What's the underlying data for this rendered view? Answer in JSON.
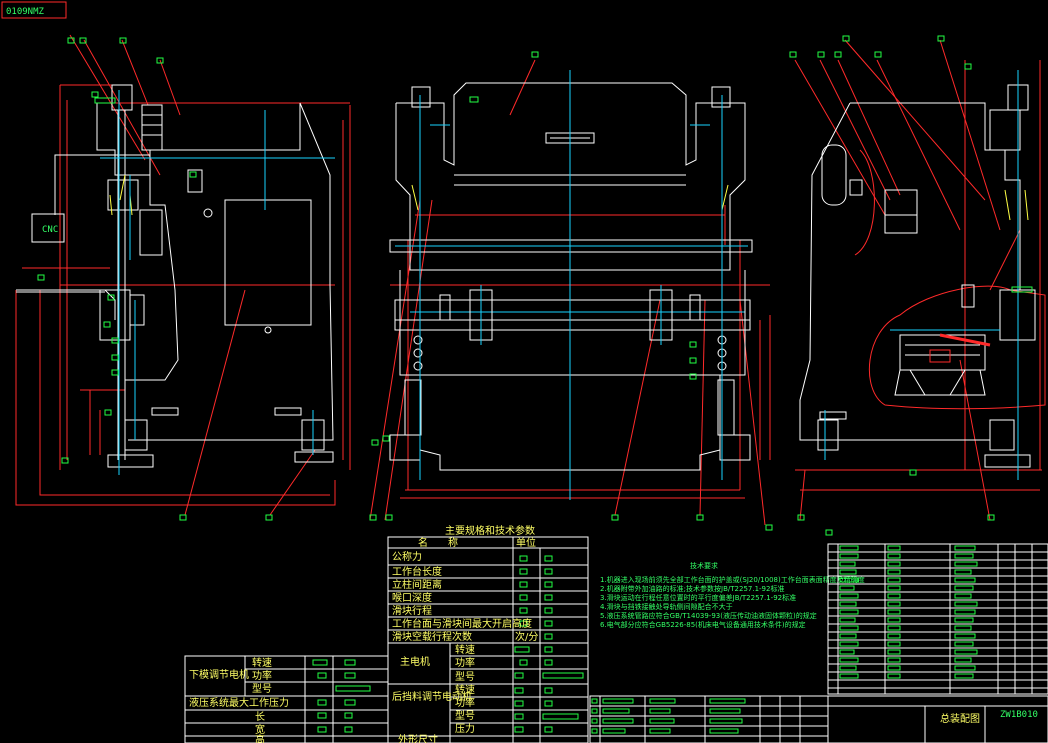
{
  "colors": {
    "outline": "#ffffff",
    "dimension": "#ff2a2a",
    "center": "#19d3ff",
    "marker": "#22ff44",
    "yellow": "#ffff44"
  },
  "title_stamp": "0109NMZ",
  "cnc_label": "CNC",
  "table_title": "主要规格和技术参数",
  "col_name": "名　　称",
  "col_unit": "单位",
  "params": [
    "公称力",
    "工作台长度",
    "立柱间距离",
    "喉口深度",
    "滑块行程",
    "工作台面与滑块间最大开启高度",
    "滑块空载行程次数"
  ],
  "stroke_unit": "次/分",
  "left_table": {
    "group_motor": "下模调节电机",
    "rows_motor": [
      "转速",
      "功率",
      "型号"
    ],
    "hydraulic": "液压系统最大工作压力",
    "size_rows": [
      "长",
      "宽",
      "高"
    ]
  },
  "main_motor": {
    "label": "主电机",
    "rows": [
      "转速",
      "功率",
      "型号"
    ]
  },
  "backgauge_motor": {
    "label": "后挡料调节电动机",
    "rows": [
      "转速",
      "功率",
      "型号",
      "压力"
    ]
  },
  "last_row": "外形尺寸",
  "tech_title": "技术要求",
  "tech_lines": [
    "1.机器进入现场前须先全部工作台面的护盖或(SJ20/1008)工作台面表面精度及精确度",
    "2.机器附带外加油路的标准;技术参数按JB/T2257.1-92标准",
    "3.滑块运动在行程任意位置时的平行度偏差JB/T2257.1-92标准",
    "4.滑块与挡铁接触处导轨侧间隙配合不大于",
    "5.液压系统管路应符合GB/T14039-93(液压传动油液固体颗粒)的规定",
    "6.电气部分应符合GB5226-85(机床电气设备通用技术条件)的规定"
  ],
  "title_block": {
    "drawing_no": "ZW1B010",
    "name": "总装配图"
  }
}
